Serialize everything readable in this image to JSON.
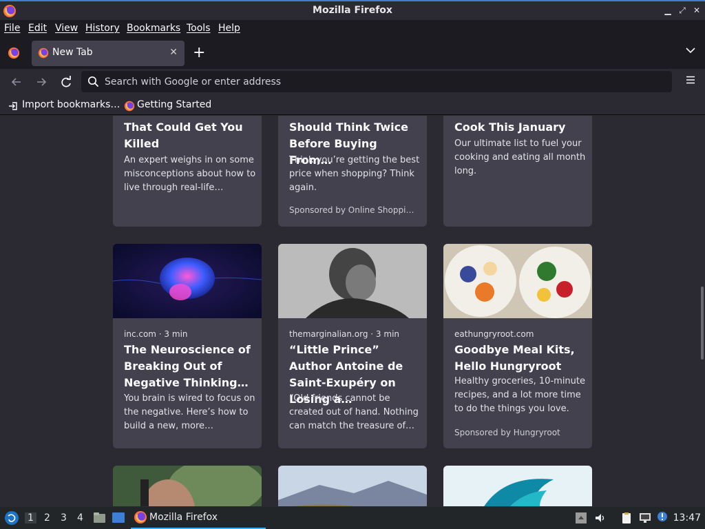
{
  "window": {
    "title": "Mozilla Firefox"
  },
  "menubar": {
    "items": [
      "File",
      "Edit",
      "View",
      "History",
      "Bookmarks",
      "Tools",
      "Help"
    ]
  },
  "tabs": {
    "active_title": "New Tab",
    "close_glyph": "✕",
    "new_tab_glyph": "+"
  },
  "navbar": {
    "url_placeholder": "Search with Google or enter address"
  },
  "bookmarks": {
    "items": [
      "Import bookmarks…",
      "Getting Started"
    ]
  },
  "stories": {
    "row1": [
      {
        "headline": "That Could Get You Killed",
        "excerpt": "An expert weighs in on some misconceptions about how to live through real-life…",
        "sponsor": ""
      },
      {
        "headline": "Should Think Twice Before Buying From…",
        "excerpt": "Think you’re getting the best price when shopping? Think again.",
        "sponsor": "Sponsored by Online Shoppi…"
      },
      {
        "headline": "Cook This January",
        "excerpt": "Our ultimate list to fuel your cooking and eating all month long.",
        "sponsor": ""
      }
    ],
    "row2": [
      {
        "source": "inc.com · 3 min",
        "headline": "The Neuroscience of Breaking Out of Negative Thinking…",
        "excerpt": "You brain is wired to focus on the negative. Here’s how to build a new, more…",
        "sponsor": ""
      },
      {
        "source": "themarginalian.org · 3 min",
        "headline": "“Little Prince” Author Antoine de Saint-Exupéry on Losing a…",
        "excerpt": "“Old friends cannot be created out of hand. Nothing can match the treasure of…",
        "sponsor": ""
      },
      {
        "source": "eathungryroot.com",
        "headline": "Goodbye Meal Kits, Hello Hungryroot",
        "excerpt": "Healthy groceries, 10-minute recipes, and a lot more time to do the things you love.",
        "sponsor": "Sponsored by Hungryroot"
      }
    ]
  },
  "taskbar": {
    "workspaces": [
      "1",
      "2",
      "3",
      "4"
    ],
    "active_workspace": "1",
    "task_label": "Mozilla Firefox",
    "clock": "13:47"
  },
  "colors": {
    "accent": "#3daee9",
    "card": "#42414d",
    "background": "#2b2a33",
    "toolbar": "#1c1b22"
  }
}
